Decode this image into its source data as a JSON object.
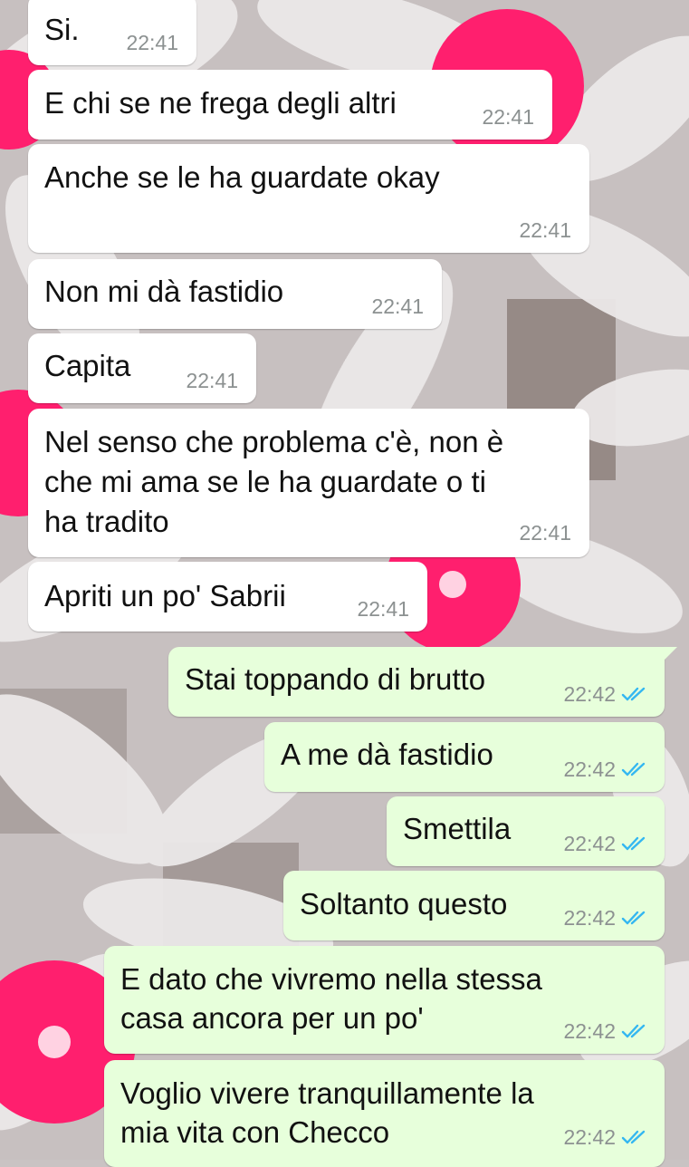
{
  "colors": {
    "incoming_bubble": "#ffffff",
    "outgoing_bubble": "#e7ffdb",
    "timestamp": "#8c9191",
    "read_ticks": "#34b7f1",
    "wallpaper_petals": "#e4e1e1",
    "wallpaper_center": "#ff1f6e"
  },
  "messages": [
    {
      "direction": "in",
      "text": "Si.",
      "time": "22:41"
    },
    {
      "direction": "in",
      "text": "E chi se ne frega degli altri",
      "time": "22:41"
    },
    {
      "direction": "in",
      "text": "Anche se le ha guardate okay",
      "time": "22:41"
    },
    {
      "direction": "in",
      "text": "Non mi dà fastidio",
      "time": "22:41"
    },
    {
      "direction": "in",
      "text": "Capita",
      "time": "22:41"
    },
    {
      "direction": "in",
      "lines": [
        "Nel senso che problema c'è, non è",
        "che mi ama se le ha guardate o ti",
        "ha tradito"
      ],
      "time": "22:41"
    },
    {
      "direction": "in",
      "text": "Apriti un po' Sabrii",
      "time": "22:41"
    },
    {
      "direction": "out",
      "text": "Stai toppando di brutto",
      "time": "22:42",
      "status_icon": "double-check-read-icon"
    },
    {
      "direction": "out",
      "text": "A me dà fastidio",
      "time": "22:42",
      "status_icon": "double-check-read-icon"
    },
    {
      "direction": "out",
      "text": "Smettila",
      "time": "22:42",
      "status_icon": "double-check-read-icon"
    },
    {
      "direction": "out",
      "text": "Soltanto questo",
      "time": "22:42",
      "status_icon": "double-check-read-icon"
    },
    {
      "direction": "out",
      "lines": [
        "E dato che vivremo nella stessa",
        "casa ancora per un po'"
      ],
      "time": "22:42",
      "status_icon": "double-check-read-icon"
    },
    {
      "direction": "out",
      "lines": [
        "Voglio vivere tranquillamente la",
        "mia vita con Checco"
      ],
      "time": "22:42",
      "status_icon": "double-check-read-icon"
    }
  ]
}
